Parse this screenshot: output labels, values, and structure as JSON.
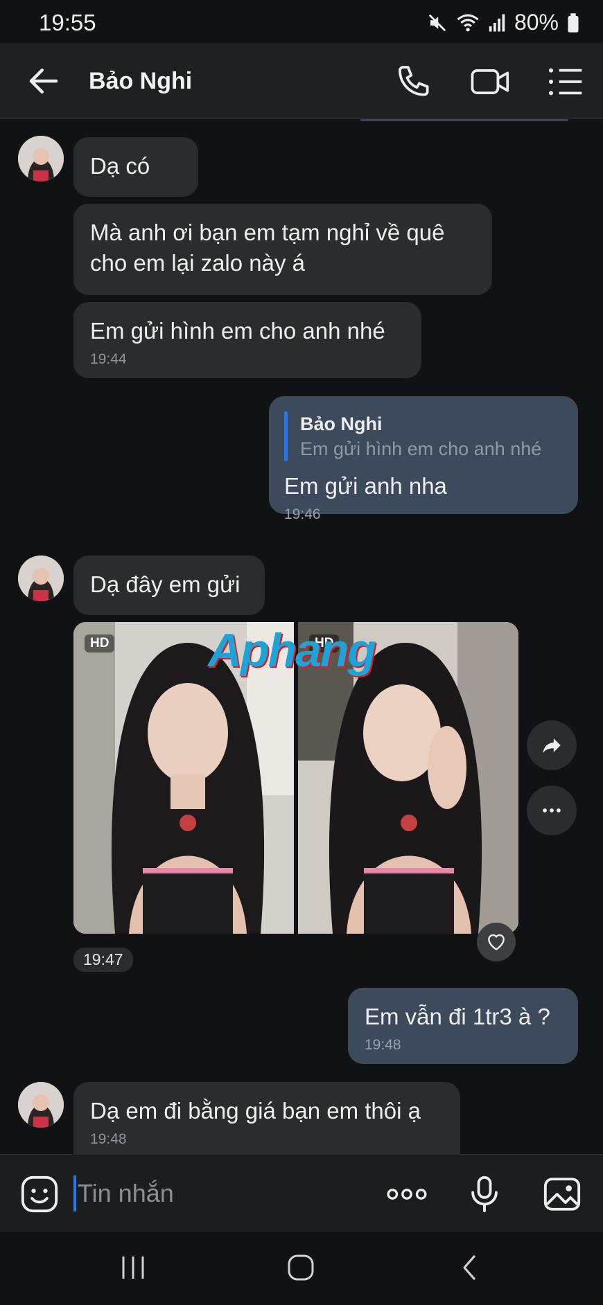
{
  "status_bar": {
    "time": "19:55",
    "battery": "80%"
  },
  "header": {
    "contact_name": "Bảo Nghi"
  },
  "messages": [
    {
      "text": "Dạ có"
    },
    {
      "text": "Mà anh ơi bạn em tạm nghỉ về quê cho em lại zalo này á"
    },
    {
      "text": "Em gửi hình em cho anh nhé",
      "time": "19:44"
    },
    {
      "quote_name": "Bảo Nghi",
      "quote_text": "Em gửi hình em cho anh nhé",
      "text": "Em gửi anh nha",
      "time": "19:46"
    },
    {
      "text": "Dạ đây em gửi"
    },
    {
      "time": "19:47",
      "hd_label": "HD"
    },
    {
      "text": "Em vẫn đi 1tr3 à ?",
      "time": "19:48"
    },
    {
      "text": "Dạ em đi bằng giá bạn em thôi ạ",
      "time": "19:48"
    }
  ],
  "watermark": "Aphang",
  "input": {
    "placeholder": "Tin nhắn"
  },
  "colors": {
    "accent": "#1e7bf0",
    "incoming_bubble": "#2b2c2e",
    "outgoing_bubble": "#3d4a5c",
    "background": "#111213"
  },
  "icons": [
    "back-arrow-icon",
    "phone-icon",
    "video-call-icon",
    "menu-list-icon",
    "share-icon",
    "more-icon",
    "heart-icon",
    "emoji-icon",
    "more-options-icon",
    "microphone-icon",
    "image-icon",
    "recents-icon",
    "home-icon",
    "back-icon"
  ]
}
